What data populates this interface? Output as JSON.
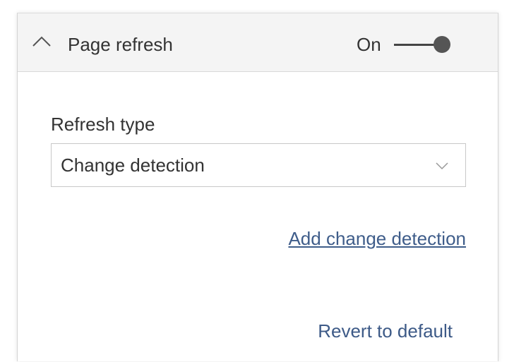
{
  "section": {
    "title": "Page refresh",
    "toggle": {
      "label": "On",
      "state": true
    }
  },
  "refresh_type": {
    "label": "Refresh type",
    "selected": "Change detection"
  },
  "actions": {
    "add_change_detection": "Add change detection",
    "revert_to_default": "Revert to default"
  },
  "colors": {
    "header_bg": "#f4f4f4",
    "text": "#333333",
    "link": "#3f5d8a",
    "toggle": "#555555"
  },
  "icons": {
    "collapse": "chevron-up-icon",
    "dropdown": "chevron-down-icon"
  }
}
